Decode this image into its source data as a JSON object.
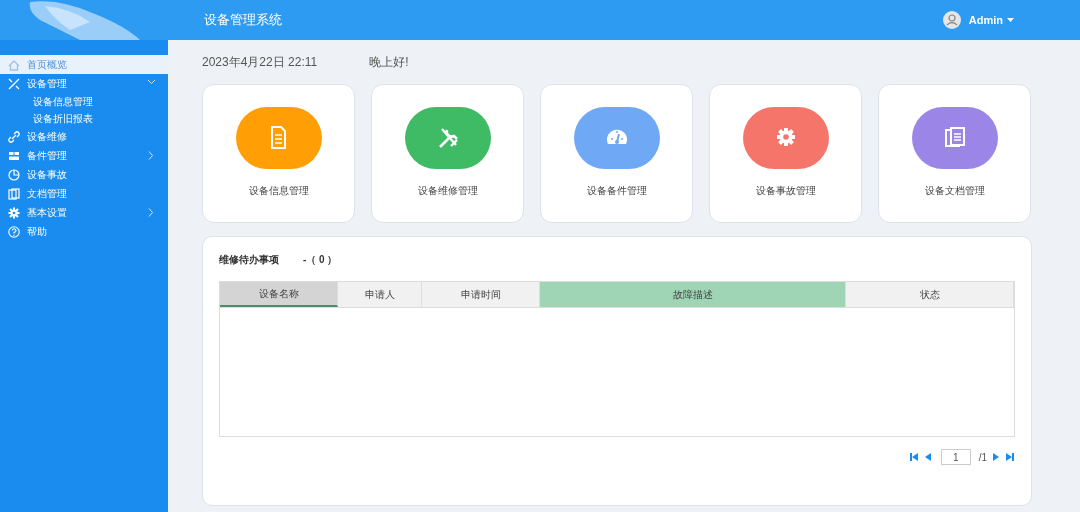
{
  "header": {
    "title": "设备管理系统",
    "user": "Admin"
  },
  "sidebar": {
    "items": [
      {
        "label": "首页概览",
        "kind": "link",
        "selected": true
      },
      {
        "label": "设备管理",
        "kind": "group",
        "expanded": true,
        "selected": false,
        "children": [
          {
            "label": "设备信息管理",
            "selected": false
          },
          {
            "label": "设备折旧报表",
            "selected": false
          }
        ]
      },
      {
        "label": "设备维修",
        "kind": "link",
        "selected": false
      },
      {
        "label": "备件管理",
        "kind": "group",
        "expanded": false,
        "selected": false
      },
      {
        "label": "设备事故",
        "kind": "link",
        "selected": false
      },
      {
        "label": "文档管理",
        "kind": "link",
        "selected": false
      },
      {
        "label": "基本设置",
        "kind": "group",
        "expanded": false,
        "selected": false
      },
      {
        "label": "帮助",
        "kind": "link",
        "selected": false
      }
    ]
  },
  "datetime": "2023年4月22日 22:11",
  "greeting": "晚上好!",
  "shortcuts": [
    {
      "label": "设备信息管理",
      "color": "#ff9f05"
    },
    {
      "label": "设备维修管理",
      "color": "#3fba65"
    },
    {
      "label": "设备备件管理",
      "color": "#6fa9f6"
    },
    {
      "label": "设备事故管理",
      "color": "#f5756a"
    },
    {
      "label": "设备文档管理",
      "color": "#9b85e6"
    }
  ],
  "todo": {
    "title": "维修待办事项",
    "count": "-（ 0 ）",
    "columns": [
      {
        "label": "设备名称",
        "selected": true,
        "highlighted": false
      },
      {
        "label": "申请人",
        "selected": false,
        "highlighted": false
      },
      {
        "label": "申请时间",
        "selected": false,
        "highlighted": false
      },
      {
        "label": "故障描述",
        "selected": false,
        "highlighted": true
      },
      {
        "label": "状态",
        "selected": false,
        "highlighted": false
      }
    ],
    "pagination": {
      "page": "1",
      "total": "/1"
    }
  }
}
